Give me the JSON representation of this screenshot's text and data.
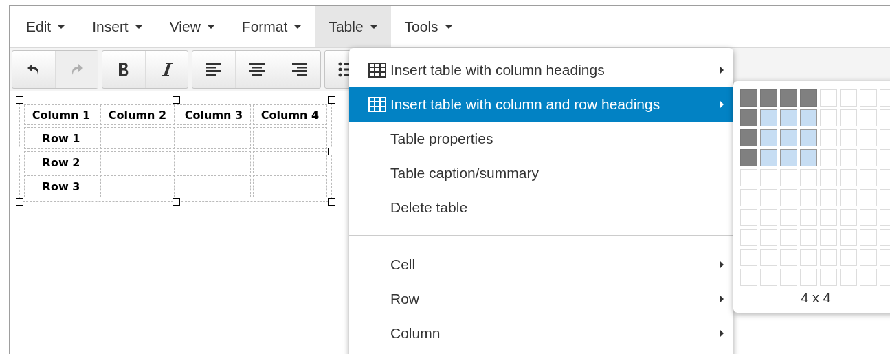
{
  "menubar": [
    {
      "label": "Edit",
      "selected": false
    },
    {
      "label": "Insert",
      "selected": false
    },
    {
      "label": "View",
      "selected": false
    },
    {
      "label": "Format",
      "selected": false
    },
    {
      "label": "Table",
      "selected": true
    },
    {
      "label": "Tools",
      "selected": false
    }
  ],
  "toolbar": [
    {
      "buttons": [
        {
          "kind": "undo",
          "disabled": false
        },
        {
          "kind": "redo",
          "disabled": true
        }
      ]
    },
    {
      "buttons": [
        {
          "kind": "bold",
          "disabled": false
        },
        {
          "kind": "italic",
          "disabled": false
        }
      ]
    },
    {
      "buttons": [
        {
          "kind": "align-left",
          "disabled": false
        },
        {
          "kind": "align-center",
          "disabled": false
        },
        {
          "kind": "align-right",
          "disabled": false
        }
      ]
    },
    {
      "buttons": [
        {
          "kind": "bullet-list",
          "disabled": false
        }
      ]
    }
  ],
  "document_table": {
    "columns": [
      "Column 1",
      "Column 2",
      "Column 3",
      "Column 4"
    ],
    "rows": [
      {
        "heading": "Row 1"
      },
      {
        "heading": "Row 2"
      },
      {
        "heading": "Row 3"
      }
    ]
  },
  "table_menu": [
    {
      "kind": "table",
      "label": "Insert table with column headings",
      "selected": false,
      "submenu": true
    },
    {
      "kind": "table",
      "label": "Insert table with column and row headings",
      "selected": true,
      "submenu": true
    },
    {
      "kind": "plain",
      "label": "Table properties",
      "selected": false,
      "submenu": false
    },
    {
      "kind": "plain",
      "label": "Table caption/summary",
      "selected": false,
      "submenu": false
    },
    {
      "kind": "plain",
      "label": "Delete table",
      "selected": false,
      "submenu": false
    },
    {
      "kind": "separator"
    },
    {
      "kind": "plain",
      "label": "Cell",
      "selected": false,
      "submenu": true
    },
    {
      "kind": "plain",
      "label": "Row",
      "selected": false,
      "submenu": true
    },
    {
      "kind": "plain",
      "label": "Column",
      "selected": false,
      "submenu": true
    }
  ],
  "grid_picker": {
    "size_label": "4 x 4",
    "rows": [
      {
        "cells": [
          {
            "kind": "heading"
          },
          {
            "kind": "heading"
          },
          {
            "kind": "heading"
          },
          {
            "kind": "heading"
          },
          {
            "kind": "empty"
          },
          {
            "kind": "empty"
          },
          {
            "kind": "empty"
          },
          {
            "kind": "empty"
          }
        ]
      },
      {
        "cells": [
          {
            "kind": "heading"
          },
          {
            "kind": "selected"
          },
          {
            "kind": "selected"
          },
          {
            "kind": "selected"
          },
          {
            "kind": "empty"
          },
          {
            "kind": "empty"
          },
          {
            "kind": "empty"
          },
          {
            "kind": "empty"
          }
        ]
      },
      {
        "cells": [
          {
            "kind": "heading"
          },
          {
            "kind": "selected"
          },
          {
            "kind": "selected"
          },
          {
            "kind": "selected"
          },
          {
            "kind": "empty"
          },
          {
            "kind": "empty"
          },
          {
            "kind": "empty"
          },
          {
            "kind": "empty"
          }
        ]
      },
      {
        "cells": [
          {
            "kind": "heading"
          },
          {
            "kind": "selected"
          },
          {
            "kind": "selected"
          },
          {
            "kind": "selected"
          },
          {
            "kind": "empty"
          },
          {
            "kind": "empty"
          },
          {
            "kind": "empty"
          },
          {
            "kind": "empty"
          }
        ]
      },
      {
        "cells": [
          {
            "kind": "empty"
          },
          {
            "kind": "empty"
          },
          {
            "kind": "empty"
          },
          {
            "kind": "empty"
          },
          {
            "kind": "empty"
          },
          {
            "kind": "empty"
          },
          {
            "kind": "empty"
          },
          {
            "kind": "empty"
          }
        ]
      },
      {
        "cells": [
          {
            "kind": "empty"
          },
          {
            "kind": "empty"
          },
          {
            "kind": "empty"
          },
          {
            "kind": "empty"
          },
          {
            "kind": "empty"
          },
          {
            "kind": "empty"
          },
          {
            "kind": "empty"
          },
          {
            "kind": "empty"
          }
        ]
      },
      {
        "cells": [
          {
            "kind": "empty"
          },
          {
            "kind": "empty"
          },
          {
            "kind": "empty"
          },
          {
            "kind": "empty"
          },
          {
            "kind": "empty"
          },
          {
            "kind": "empty"
          },
          {
            "kind": "empty"
          },
          {
            "kind": "empty"
          }
        ]
      },
      {
        "cells": [
          {
            "kind": "empty"
          },
          {
            "kind": "empty"
          },
          {
            "kind": "empty"
          },
          {
            "kind": "empty"
          },
          {
            "kind": "empty"
          },
          {
            "kind": "empty"
          },
          {
            "kind": "empty"
          },
          {
            "kind": "empty"
          }
        ]
      },
      {
        "cells": [
          {
            "kind": "empty"
          },
          {
            "kind": "empty"
          },
          {
            "kind": "empty"
          },
          {
            "kind": "empty"
          },
          {
            "kind": "empty"
          },
          {
            "kind": "empty"
          },
          {
            "kind": "empty"
          },
          {
            "kind": "empty"
          }
        ]
      },
      {
        "cells": [
          {
            "kind": "empty"
          },
          {
            "kind": "empty"
          },
          {
            "kind": "empty"
          },
          {
            "kind": "empty"
          },
          {
            "kind": "empty"
          },
          {
            "kind": "empty"
          },
          {
            "kind": "empty"
          },
          {
            "kind": "empty"
          }
        ]
      }
    ]
  }
}
